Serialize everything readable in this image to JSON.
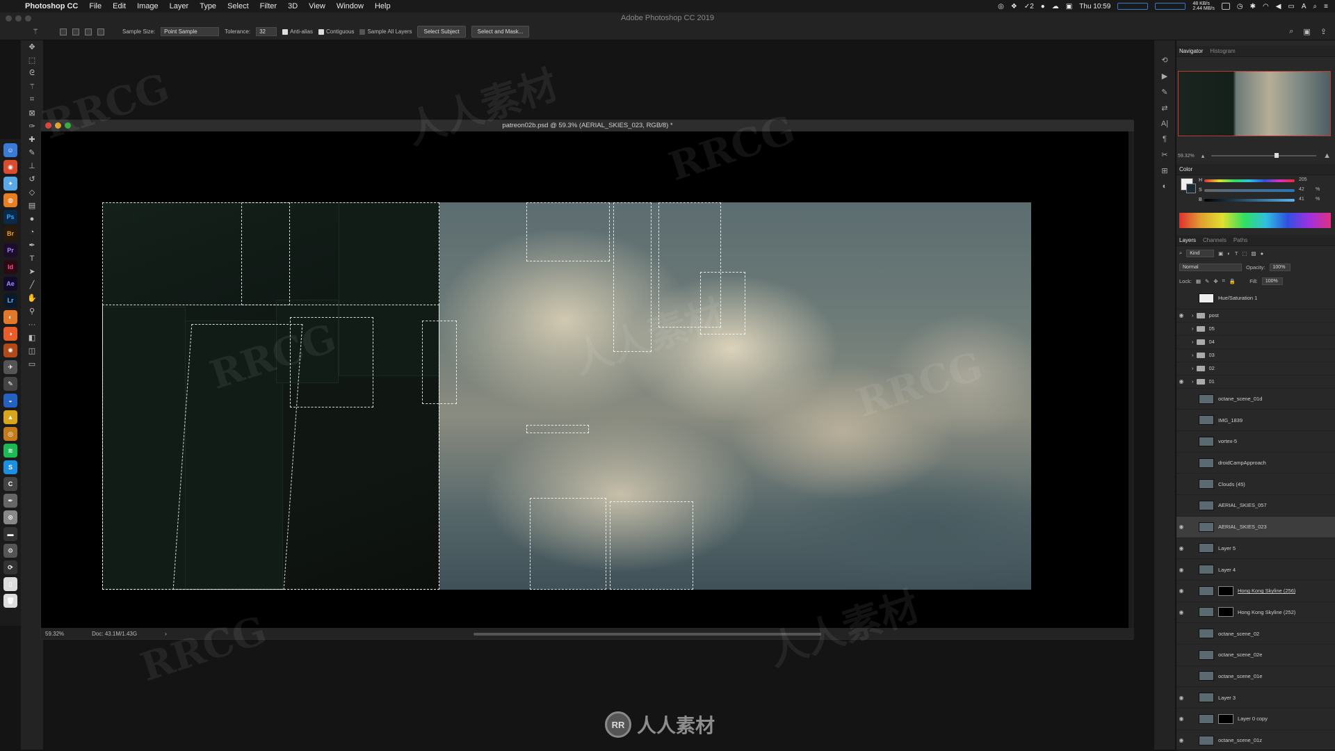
{
  "menubar": {
    "app_name": "Photoshop CC",
    "items": [
      "File",
      "Edit",
      "Image",
      "Layer",
      "Type",
      "Select",
      "Filter",
      "3D",
      "View",
      "Window",
      "Help"
    ],
    "battery_label": "2",
    "net_up": "48 KB/s",
    "net_down": "2.44 MB/s",
    "clock": "Thu 10:59",
    "user_initial": "A"
  },
  "app_title": "Adobe Photoshop CC 2019",
  "options": {
    "sample_size_label": "Sample Size:",
    "sample_size_value": "Point Sample",
    "tolerance_label": "Tolerance:",
    "tolerance_value": "32",
    "anti_alias": "Anti-alias",
    "contiguous": "Contiguous",
    "sample_all_layers": "Sample All Layers",
    "select_subject": "Select Subject",
    "select_and_mask": "Select and Mask..."
  },
  "document": {
    "title": "patreon02b.psd @ 59.3% (AERIAL_SKIES_023, RGB/8) *",
    "zoom": "59.32%",
    "doc_info": "Doc: 43.1M/1.43G"
  },
  "dock_apps": [
    "Ps",
    "Br",
    "Pr",
    "Id",
    "Ae",
    "Lr"
  ],
  "navigator": {
    "tabs": [
      "Navigator",
      "Histogram"
    ],
    "zoom": "59.32%"
  },
  "color": {
    "title": "Color",
    "h": "205",
    "s": "42",
    "b": "41",
    "h_label": "H",
    "s_label": "S",
    "b_label": "B",
    "pct": "%"
  },
  "layers": {
    "tabs": [
      "Layers",
      "Channels",
      "Paths"
    ],
    "kind": "Kind",
    "blend_mode": "Normal",
    "opacity_label": "Opacity:",
    "opacity_value": "100%",
    "lock_label": "Lock:",
    "fill_label": "Fill:",
    "fill_value": "100%",
    "list": [
      {
        "name": "Hue/Saturation 1",
        "type": "adj",
        "visible": false
      },
      {
        "name": "post",
        "type": "folder",
        "visible": true
      },
      {
        "name": "05",
        "type": "folder",
        "visible": false
      },
      {
        "name": "04",
        "type": "folder",
        "visible": false
      },
      {
        "name": "03",
        "type": "folder",
        "visible": false
      },
      {
        "name": "02",
        "type": "folder",
        "visible": false
      },
      {
        "name": "01",
        "type": "folder",
        "visible": true
      },
      {
        "name": "octane_scene_01d",
        "type": "img",
        "visible": false
      },
      {
        "name": "IMG_1839",
        "type": "img",
        "visible": false
      },
      {
        "name": "vortex-5",
        "type": "img",
        "visible": false
      },
      {
        "name": "droidCampApproach",
        "type": "img",
        "visible": false
      },
      {
        "name": "Clouds (45)",
        "type": "img",
        "visible": false
      },
      {
        "name": "AERIAL_SKIES_057",
        "type": "img",
        "visible": false
      },
      {
        "name": "AERIAL_SKIES_023",
        "type": "img",
        "visible": true,
        "selected": true
      },
      {
        "name": "Layer 5",
        "type": "img",
        "visible": true
      },
      {
        "name": "Layer 4",
        "type": "img",
        "visible": true
      },
      {
        "name": "Hong Kong Skyline (256)",
        "type": "mask",
        "visible": true,
        "underline": true
      },
      {
        "name": "Hong Kong Skyline (252)",
        "type": "mask",
        "visible": true
      },
      {
        "name": "octane_scene_02",
        "type": "img",
        "visible": false
      },
      {
        "name": "octane_scene_02e",
        "type": "img",
        "visible": false
      },
      {
        "name": "octane_scene_01e",
        "type": "img",
        "visible": false
      },
      {
        "name": "Layer 3",
        "type": "img",
        "visible": true
      },
      {
        "name": "Layer 0 copy",
        "type": "mask",
        "visible": true
      },
      {
        "name": "octane_scene_01z",
        "type": "img",
        "visible": true
      }
    ]
  },
  "watermark": {
    "logo_text": "人人素材",
    "logo_badge": "RR",
    "marks": [
      "RRCG",
      "人人素材"
    ]
  }
}
